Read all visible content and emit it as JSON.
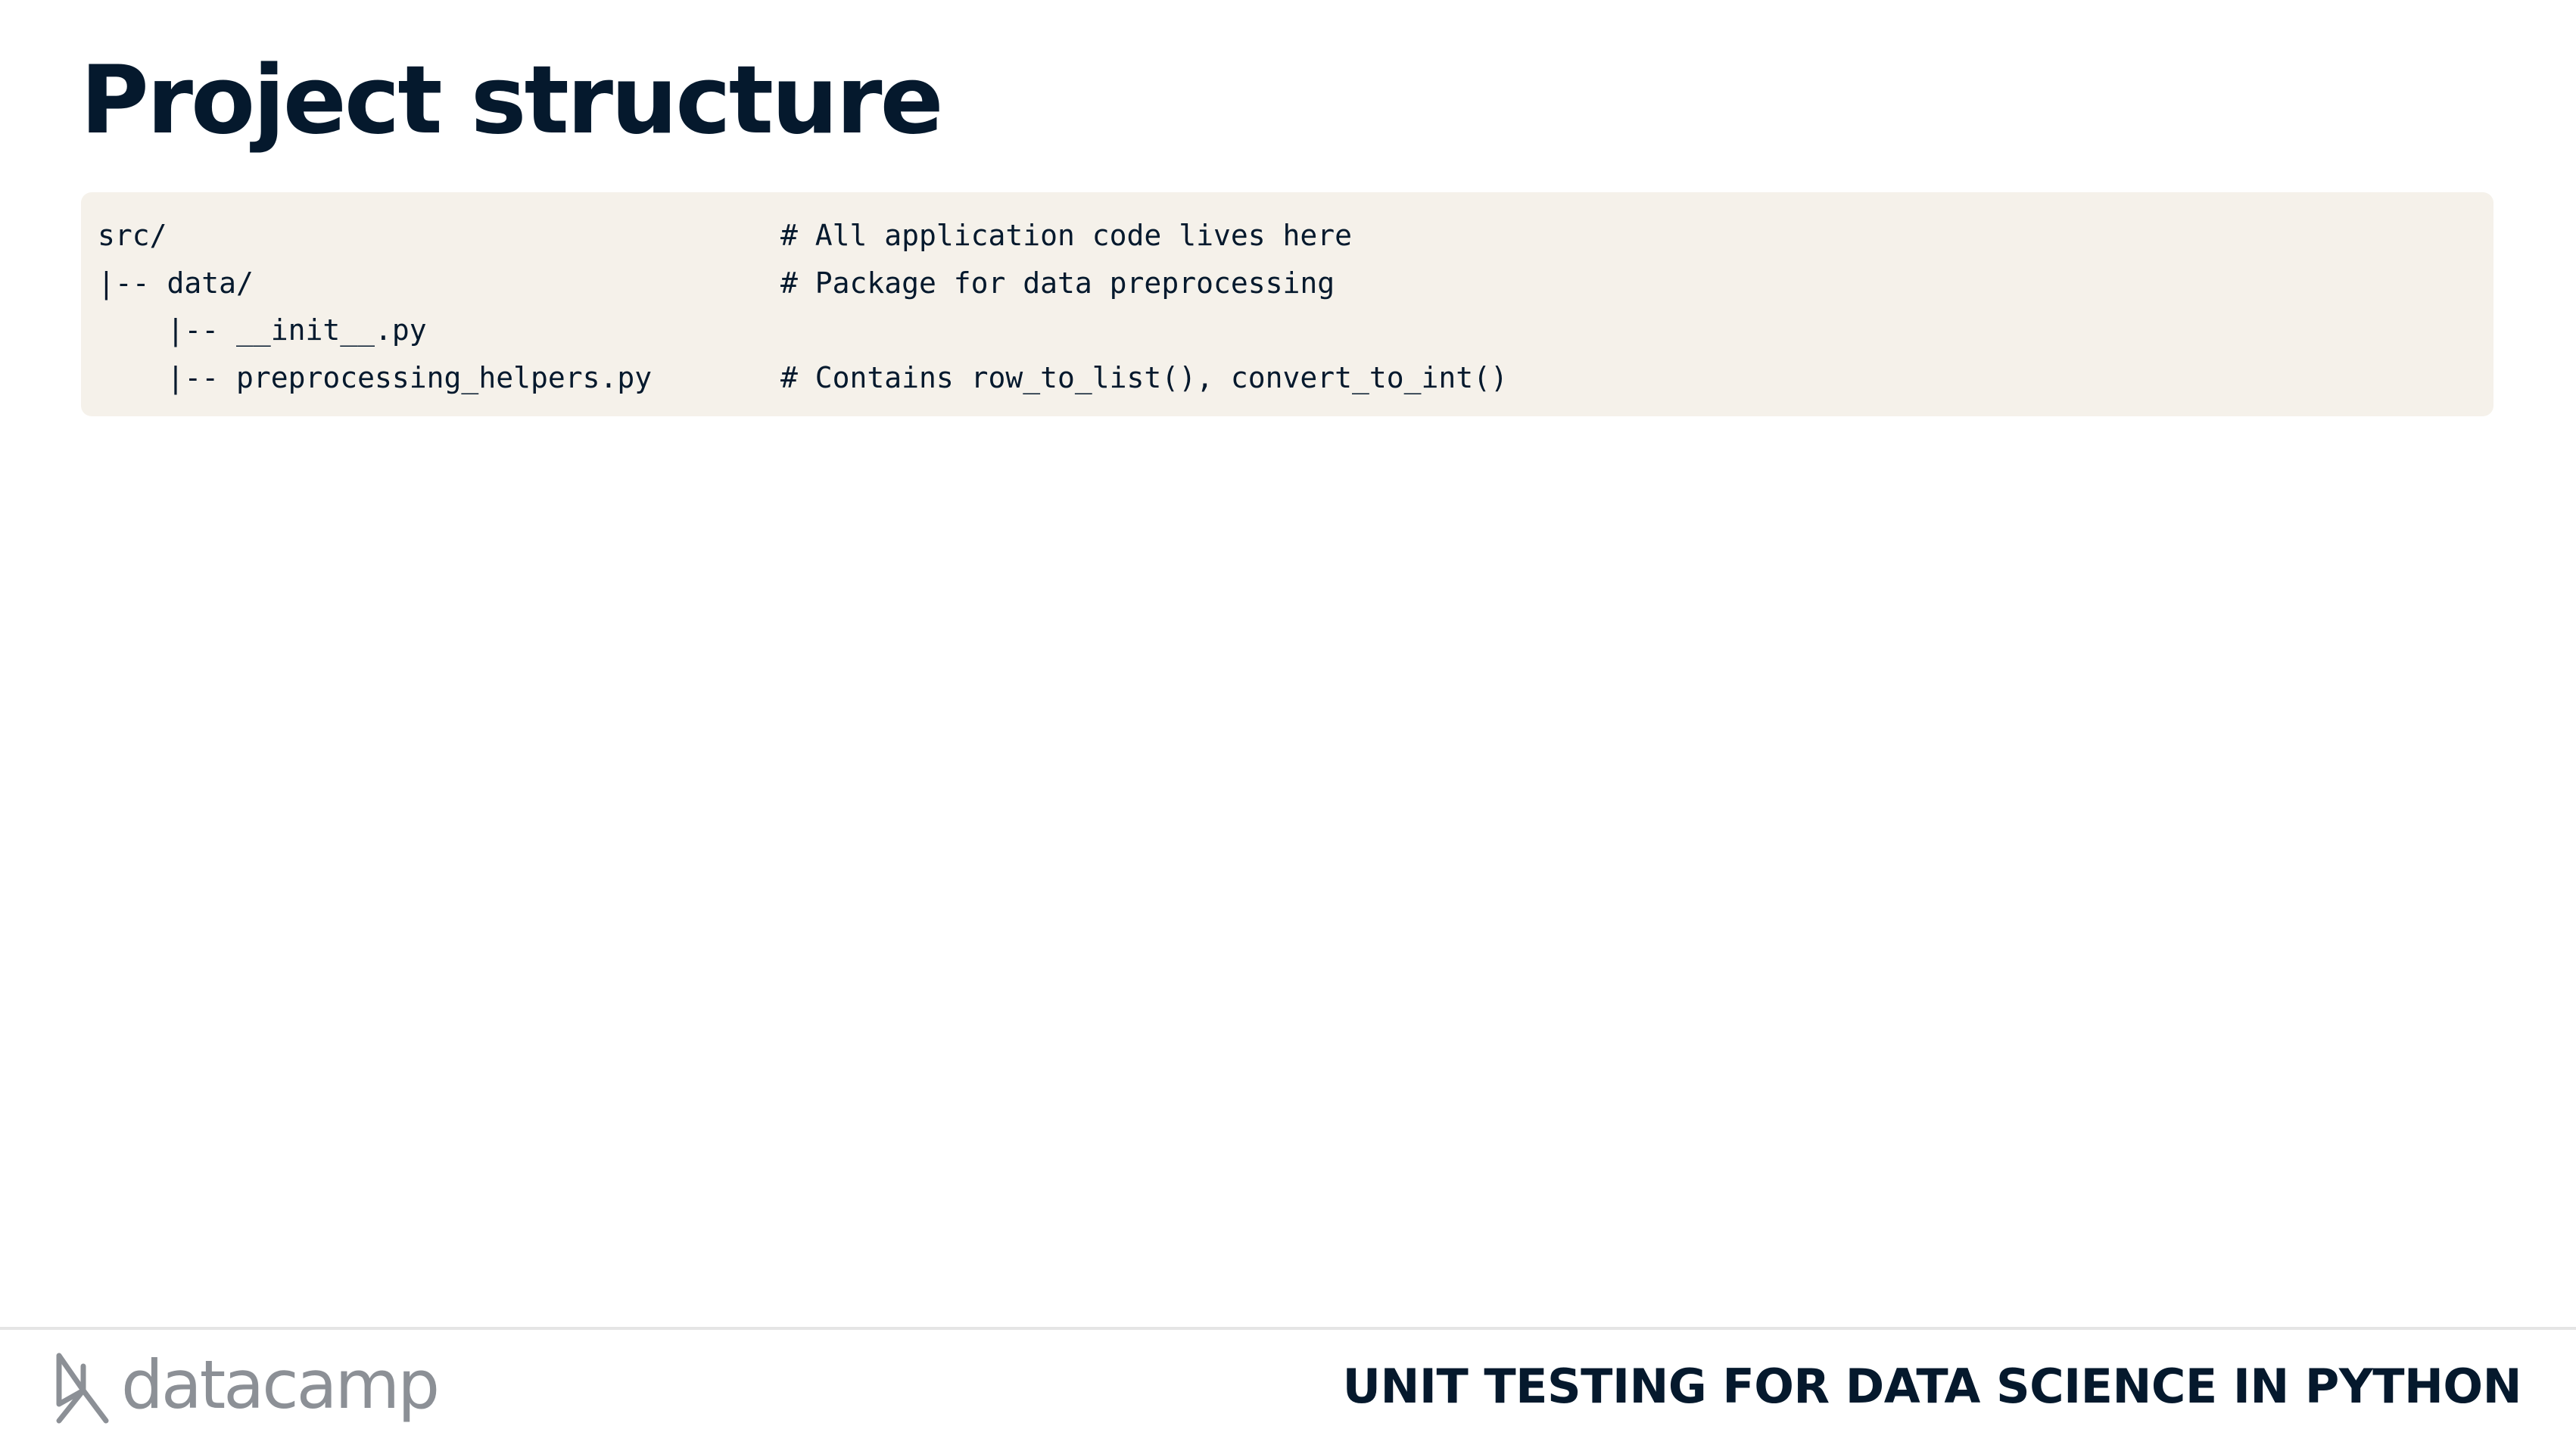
{
  "slide": {
    "title": "Project structure"
  },
  "code_block": {
    "lines": [
      {
        "path": "src/",
        "comment": "# All application code lives here"
      },
      {
        "path": "|-- data/",
        "comment": "# Package for data preprocessing"
      },
      {
        "path": "    |-- __init__.py",
        "comment": ""
      },
      {
        "path": "    |-- preprocessing_helpers.py",
        "comment": "# Contains row_to_list(), convert_to_int()"
      }
    ]
  },
  "footer": {
    "logo_text": "datacamp",
    "course_title": "UNIT TESTING FOR DATA SCIENCE IN PYTHON"
  },
  "colors": {
    "title": "#05192d",
    "code_background": "#f5f1ea",
    "logo": "#8c9096"
  }
}
